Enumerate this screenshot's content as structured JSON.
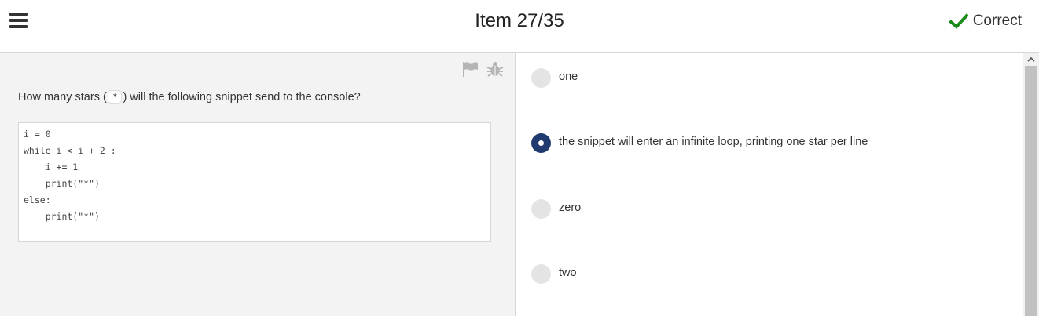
{
  "header": {
    "menu_icon": "hamburger-menu-icon",
    "title": "Item 27/35",
    "status_label": "Correct",
    "status_icon": "checkmark-icon",
    "status_color": "#1a8a1a"
  },
  "question": {
    "text_before": "How many stars (",
    "code_token": "*",
    "text_after": ") will the following snippet send to the console?",
    "code": "i = 0\nwhile i < i + 2 :\n    i += 1\n    print(\"*\")\nelse:\n    print(\"*\")",
    "tool_icons": [
      "flag-icon",
      "bug-icon"
    ]
  },
  "answers": [
    {
      "label": "one",
      "selected": false
    },
    {
      "label": "the snippet will enter an infinite loop, printing one star per line",
      "selected": true
    },
    {
      "label": "zero",
      "selected": false
    },
    {
      "label": "two",
      "selected": false
    }
  ],
  "colors": {
    "selected_radio": "#1e3a6e",
    "left_pane_bg": "#f3f3f3"
  }
}
